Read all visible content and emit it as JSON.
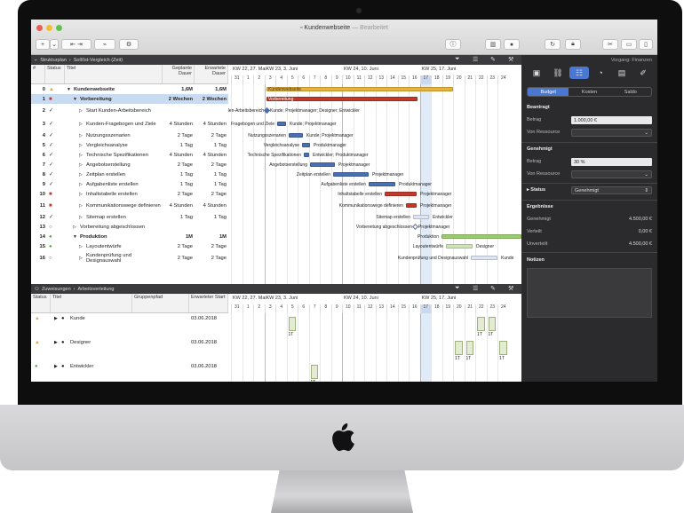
{
  "window": {
    "title": "Kundenwebseite",
    "subtitle": "— Bearbeitet"
  },
  "toolbar": {
    "add": "+",
    "add_menu": "⌄",
    "share": "↗",
    "settings": "⚙"
  },
  "breadcrumb_top": {
    "part1": "Strukturplan",
    "part2": "Soll/Ist-Vergleich (Zeit)"
  },
  "breadcrumb_bottom": {
    "part1": "Zuweisungen",
    "part2": "Arbeitsverteilung"
  },
  "top_columns": {
    "num": "#",
    "status": "Status",
    "title": "Titel",
    "planned": "Geplante Dauer",
    "expected": "Erwartete Dauer"
  },
  "bottom_columns": {
    "status": "Status",
    "title": "Titel",
    "group": "Gruppenpfad",
    "expected_start": "Erwarteter Start"
  },
  "weeks_top": [
    "KW 22, 27. Mai",
    "KW 23, 3. Juni",
    "KW 24, 10. Juni",
    "KW 25, 17. Juni"
  ],
  "weeks_bottom": [
    "KW 22, 27. Mai",
    "KW 23, 3. Juni",
    "KW 24, 10. Juni",
    "KW 25, 17. Juni"
  ],
  "days": [
    "31",
    "1",
    "2",
    "3",
    "4",
    "5",
    "6",
    "7",
    "8",
    "9",
    "10",
    "11",
    "12",
    "13",
    "14",
    "15",
    "16",
    "17",
    "18",
    "19",
    "20",
    "21",
    "22",
    "23",
    "24"
  ],
  "tasks": [
    {
      "num": "0",
      "status": "▲",
      "status_color": "#e8a23a",
      "indent": 0,
      "toggle": "▼",
      "title": "Kundenwebseite",
      "planned": "1,6M",
      "expected": "1,6M",
      "bold": true
    },
    {
      "num": "1",
      "status": "■",
      "status_color": "#c0392b",
      "indent": 1,
      "toggle": "▼",
      "title": "Vorbereitung",
      "planned": "2 Wochen",
      "expected": "2 Wochen",
      "bold": true,
      "sel": true
    },
    {
      "num": "2",
      "status": "✓",
      "status_color": "#333",
      "indent": 2,
      "toggle": "▷",
      "title": "Start Kunden-Arbeitsbereich",
      "planned": "",
      "expected": "",
      "tall": true
    },
    {
      "num": "3",
      "status": "✓",
      "status_color": "#333",
      "indent": 2,
      "toggle": "▷",
      "title": "Kunden-Fragebogen und Ziele",
      "planned": "4 Stunden",
      "expected": "4 Stunden",
      "tall": true
    },
    {
      "num": "4",
      "status": "✓",
      "status_color": "#333",
      "indent": 2,
      "toggle": "▷",
      "title": "Nutzungsszenarien",
      "planned": "2 Tage",
      "expected": "2 Tage"
    },
    {
      "num": "5",
      "status": "✓",
      "status_color": "#333",
      "indent": 2,
      "toggle": "▷",
      "title": "Vergleichsanalyse",
      "planned": "1 Tag",
      "expected": "1 Tag"
    },
    {
      "num": "6",
      "status": "✓",
      "status_color": "#333",
      "indent": 2,
      "toggle": "▷",
      "title": "Technische Spezifikationen",
      "planned": "4 Stunden",
      "expected": "4 Stunden"
    },
    {
      "num": "7",
      "status": "✓",
      "status_color": "#333",
      "indent": 2,
      "toggle": "▷",
      "title": "Angebotserstellung",
      "planned": "2 Tage",
      "expected": "2 Tage"
    },
    {
      "num": "8",
      "status": "✓",
      "status_color": "#333",
      "indent": 2,
      "toggle": "▷",
      "title": "Zeitplan erstellen",
      "planned": "1 Tag",
      "expected": "1 Tag"
    },
    {
      "num": "9",
      "status": "✓",
      "status_color": "#333",
      "indent": 2,
      "toggle": "▷",
      "title": "Aufgabenliste erstellen",
      "planned": "1 Tag",
      "expected": "1 Tag"
    },
    {
      "num": "10",
      "status": "■",
      "status_color": "#c0392b",
      "indent": 2,
      "toggle": "▷",
      "title": "Inhaltstabelle erstellen",
      "planned": "2 Tage",
      "expected": "2 Tage"
    },
    {
      "num": "11",
      "status": "■",
      "status_color": "#c0392b",
      "indent": 2,
      "toggle": "▷",
      "title": "Kommunikationswege definieren",
      "planned": "4 Stunden",
      "expected": "4 Stunden",
      "tall": true
    },
    {
      "num": "12",
      "status": "✓",
      "status_color": "#333",
      "indent": 2,
      "toggle": "▷",
      "title": "Sitemap erstellen",
      "planned": "1 Tag",
      "expected": "1 Tag"
    },
    {
      "num": "13",
      "status": "○",
      "status_color": "#555",
      "indent": 1,
      "toggle": "▷",
      "title": "Vorbereitung abgeschlossen",
      "planned": "",
      "expected": ""
    },
    {
      "num": "14",
      "status": "●",
      "status_color": "#5aa838",
      "indent": 1,
      "toggle": "▼",
      "title": "Produktion",
      "planned": "1M",
      "expected": "1M",
      "bold": true
    },
    {
      "num": "15",
      "status": "●",
      "status_color": "#5aa838",
      "indent": 2,
      "toggle": "▷",
      "title": "Layoutentwürfe",
      "planned": "2 Tage",
      "expected": "2 Tage"
    },
    {
      "num": "16",
      "status": "○",
      "status_color": "#555",
      "indent": 2,
      "toggle": "▷",
      "title": "Kundenprüfung und Designauswahl",
      "planned": "2 Tage",
      "expected": "2 Tage",
      "tall": true
    }
  ],
  "gantt_labels": [
    "Kundenwebseite",
    "Vorbereitung",
    "Kunden-Arbeitsbereich",
    "Kunde; Projektmanager; Designer; Entwickler",
    "Fragebogen und Ziele",
    "Kunde; Projektmanager",
    "Nutzungsszenarien",
    "Kunde; Projektmanager",
    "Vergleichsanalyse",
    "Produktmanager",
    "Technische Spezifikationen",
    "Entwickler; Produktmanager",
    "Angebotserstellung",
    "Projektmanager",
    "Zeitplan erstellen",
    "Projektmanager",
    "Aufgabenliste erstellen",
    "Produktmanager",
    "Inhaltstabelle erstellen",
    "Projektmanager",
    "Kommunikationswege definieren",
    "Projektmanager",
    "Sitemap erstellen",
    "Entwickler",
    "Vorbereitung abgeschlossen",
    "Projektmanager",
    "Produktion",
    "Layoutentwürfe",
    "Designer",
    "Kundenprüfung und Designauswahl",
    "Kunde"
  ],
  "resources": [
    {
      "status": "▲",
      "status_color": "#e8a23a",
      "title": "Kunde",
      "start": "03.06.2018"
    },
    {
      "status": "▲",
      "status_color": "#e8a23a",
      "title": "Designer",
      "start": "03.06.2018"
    },
    {
      "status": "●",
      "status_color": "#5aa838",
      "title": "Entwickler",
      "start": "03.06.2018"
    }
  ],
  "res_marks": [
    "1T",
    "1T",
    "1T",
    "1T",
    "1T",
    "1T",
    "1T"
  ],
  "inspector": {
    "header": "Vorgang: Finanzen",
    "segments": [
      "Budget",
      "Kosten",
      "Saldo"
    ],
    "budget_title": "Beantragt",
    "amount_label": "Betrag",
    "amount_value": "1.000,00 €",
    "resource_label": "Von Ressource",
    "approved_title": "Genehmigt",
    "approved_amount_label": "Betrag",
    "approved_amount_value": "30 %",
    "approved_resource_label": "Von Ressource",
    "status_label": "Status",
    "status_value": "Genehmigt",
    "results_title": "Ergebnisse",
    "res_approved_label": "Genehmigt",
    "res_approved_value": "4.500,00 €",
    "res_distributed_label": "Verteilt",
    "res_distributed_value": "0,00 €",
    "res_undistributed_label": "Unverteilt",
    "res_undistributed_value": "4.500,00 €",
    "notes_title": "Notizen"
  }
}
